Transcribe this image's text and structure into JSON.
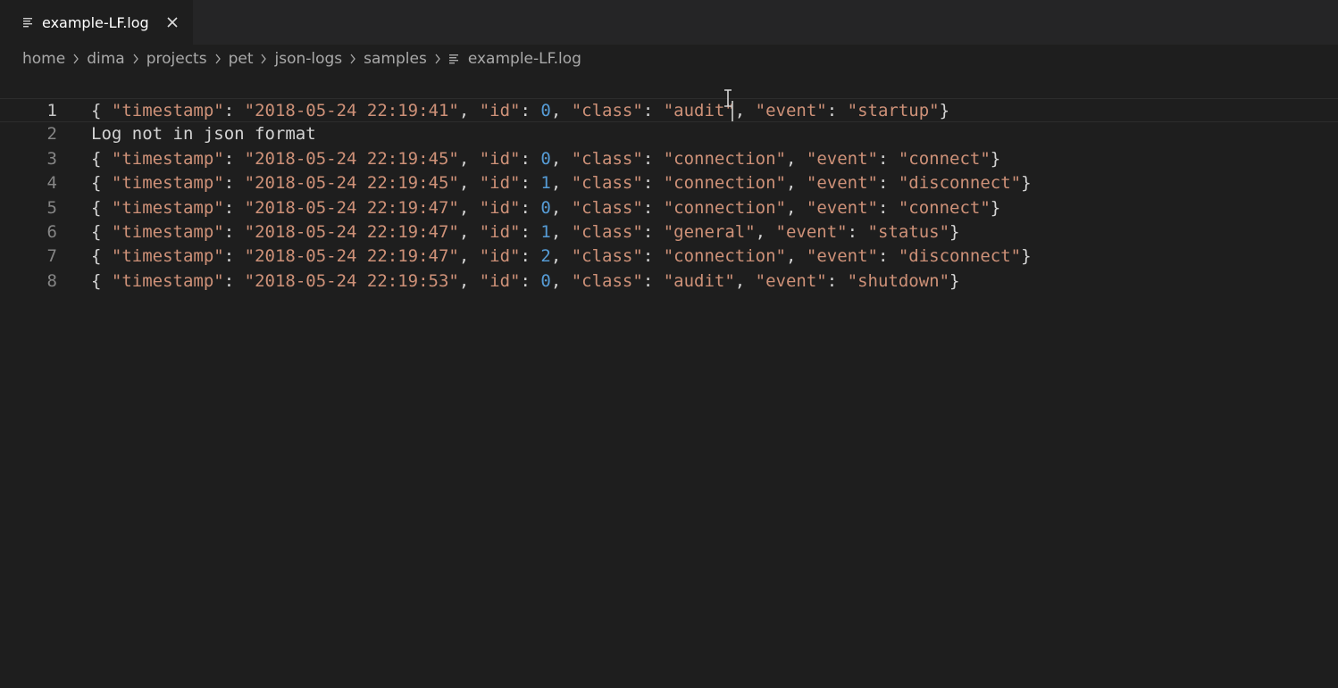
{
  "tab": {
    "label": "example-LF.log",
    "icon": "file-lines-icon",
    "close_icon": "close-icon"
  },
  "breadcrumb": {
    "items": [
      "home",
      "dima",
      "projects",
      "pet",
      "json-logs",
      "samples"
    ],
    "file": "example-LF.log"
  },
  "editor": {
    "current_line": 1,
    "lines": [
      {
        "number": "1",
        "kind": "json",
        "timestamp": "2018-05-24 22:19:41",
        "id": "0",
        "class": "audit",
        "event": "startup"
      },
      {
        "number": "2",
        "kind": "text",
        "text": "Log not in json format"
      },
      {
        "number": "3",
        "kind": "json",
        "timestamp": "2018-05-24 22:19:45",
        "id": "0",
        "class": "connection",
        "event": "connect"
      },
      {
        "number": "4",
        "kind": "json",
        "timestamp": "2018-05-24 22:19:45",
        "id": "1",
        "class": "connection",
        "event": "disconnect"
      },
      {
        "number": "5",
        "kind": "json",
        "timestamp": "2018-05-24 22:19:47",
        "id": "0",
        "class": "connection",
        "event": "connect"
      },
      {
        "number": "6",
        "kind": "json",
        "timestamp": "2018-05-24 22:19:47",
        "id": "1",
        "class": "general",
        "event": "status"
      },
      {
        "number": "7",
        "kind": "json",
        "timestamp": "2018-05-24 22:19:47",
        "id": "2",
        "class": "connection",
        "event": "disconnect"
      },
      {
        "number": "8",
        "kind": "json",
        "timestamp": "2018-05-24 22:19:53",
        "id": "0",
        "class": "audit",
        "event": "shutdown"
      }
    ]
  },
  "colors": {
    "background": "#1e1e1e",
    "tabbar": "#252526",
    "string": "#ce9178",
    "number": "#569cd6",
    "text": "#d4d4d4",
    "line_number": "#858585"
  }
}
